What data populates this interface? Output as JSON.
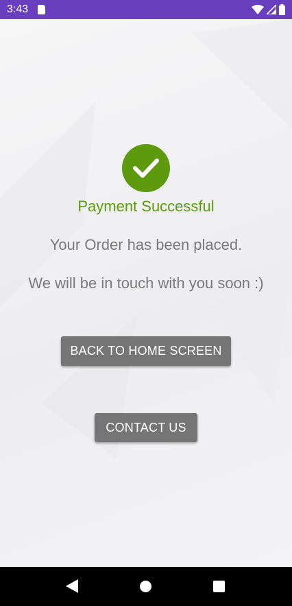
{
  "status_bar": {
    "time": "3:43",
    "icons": [
      "sd-card-icon",
      "wifi-icon",
      "signal-icon",
      "battery-icon"
    ]
  },
  "main": {
    "icon": "check-circle-icon",
    "title": "Payment Successful",
    "message_1": "Your Order has been placed.",
    "message_2": "We will be in touch with you soon :)",
    "home_button_label": "BACK TO HOME SCREEN",
    "contact_button_label": "CONTACT US"
  },
  "nav_bar": {
    "icons": [
      "back-icon",
      "home-icon",
      "recents-icon"
    ]
  },
  "colors": {
    "status_bar": "#6a3fbf",
    "success_green": "#5e9a0d",
    "message_gray": "#7a7a7a",
    "button_gray": "#757575"
  }
}
